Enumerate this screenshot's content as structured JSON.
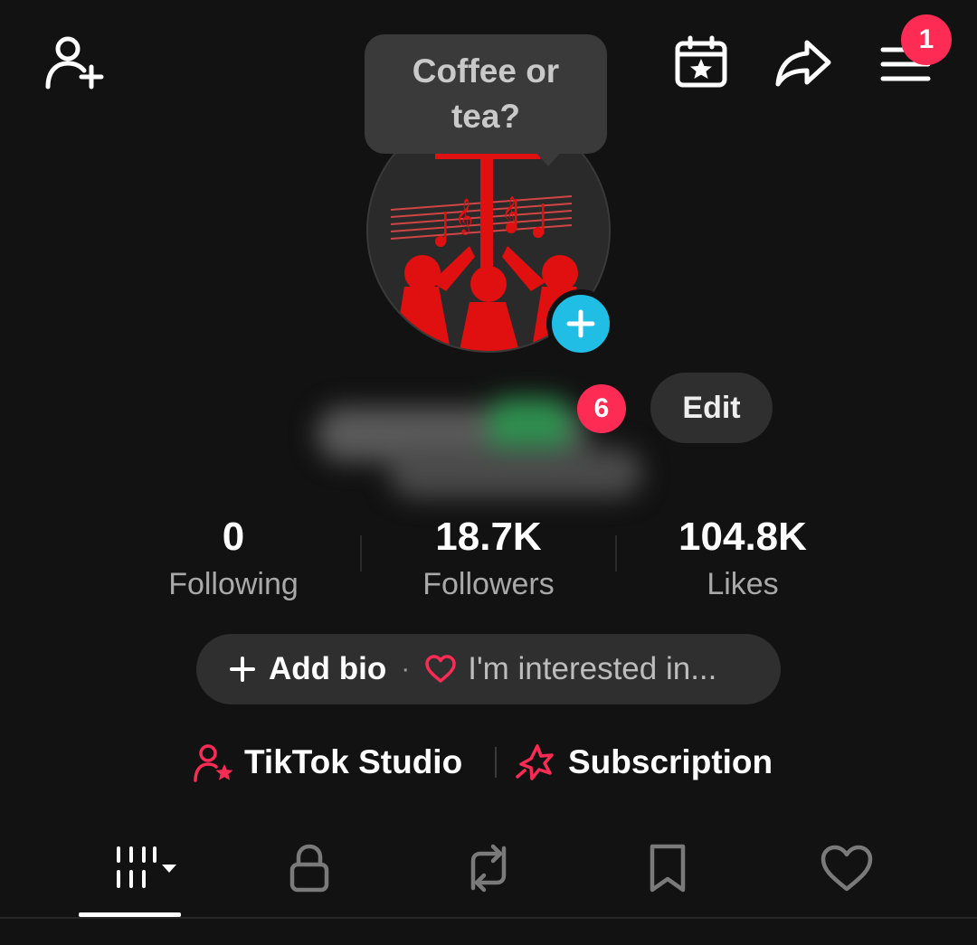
{
  "header": {
    "bubble_text": "Coffee or tea?",
    "notification_count": "1"
  },
  "profile": {
    "badge_count": "6",
    "edit_label": "Edit"
  },
  "stats": [
    {
      "value": "0",
      "label": "Following"
    },
    {
      "value": "18.7K",
      "label": "Followers"
    },
    {
      "value": "104.8K",
      "label": "Likes"
    }
  ],
  "bio": {
    "add_label": "Add bio",
    "separator": "·",
    "interests_label": "I'm interested in..."
  },
  "links": {
    "studio_label": "TikTok Studio",
    "subscription_label": "Subscription"
  },
  "colors": {
    "accent": "#fe2c55",
    "avatar_plus": "#20bde4",
    "background": "#121212"
  },
  "icons": [
    "add-friend-icon",
    "calendar-star-icon",
    "share-icon",
    "menu-icon",
    "videos-grid-icon",
    "lock-icon",
    "repost-icon",
    "bookmark-icon",
    "heart-icon"
  ]
}
